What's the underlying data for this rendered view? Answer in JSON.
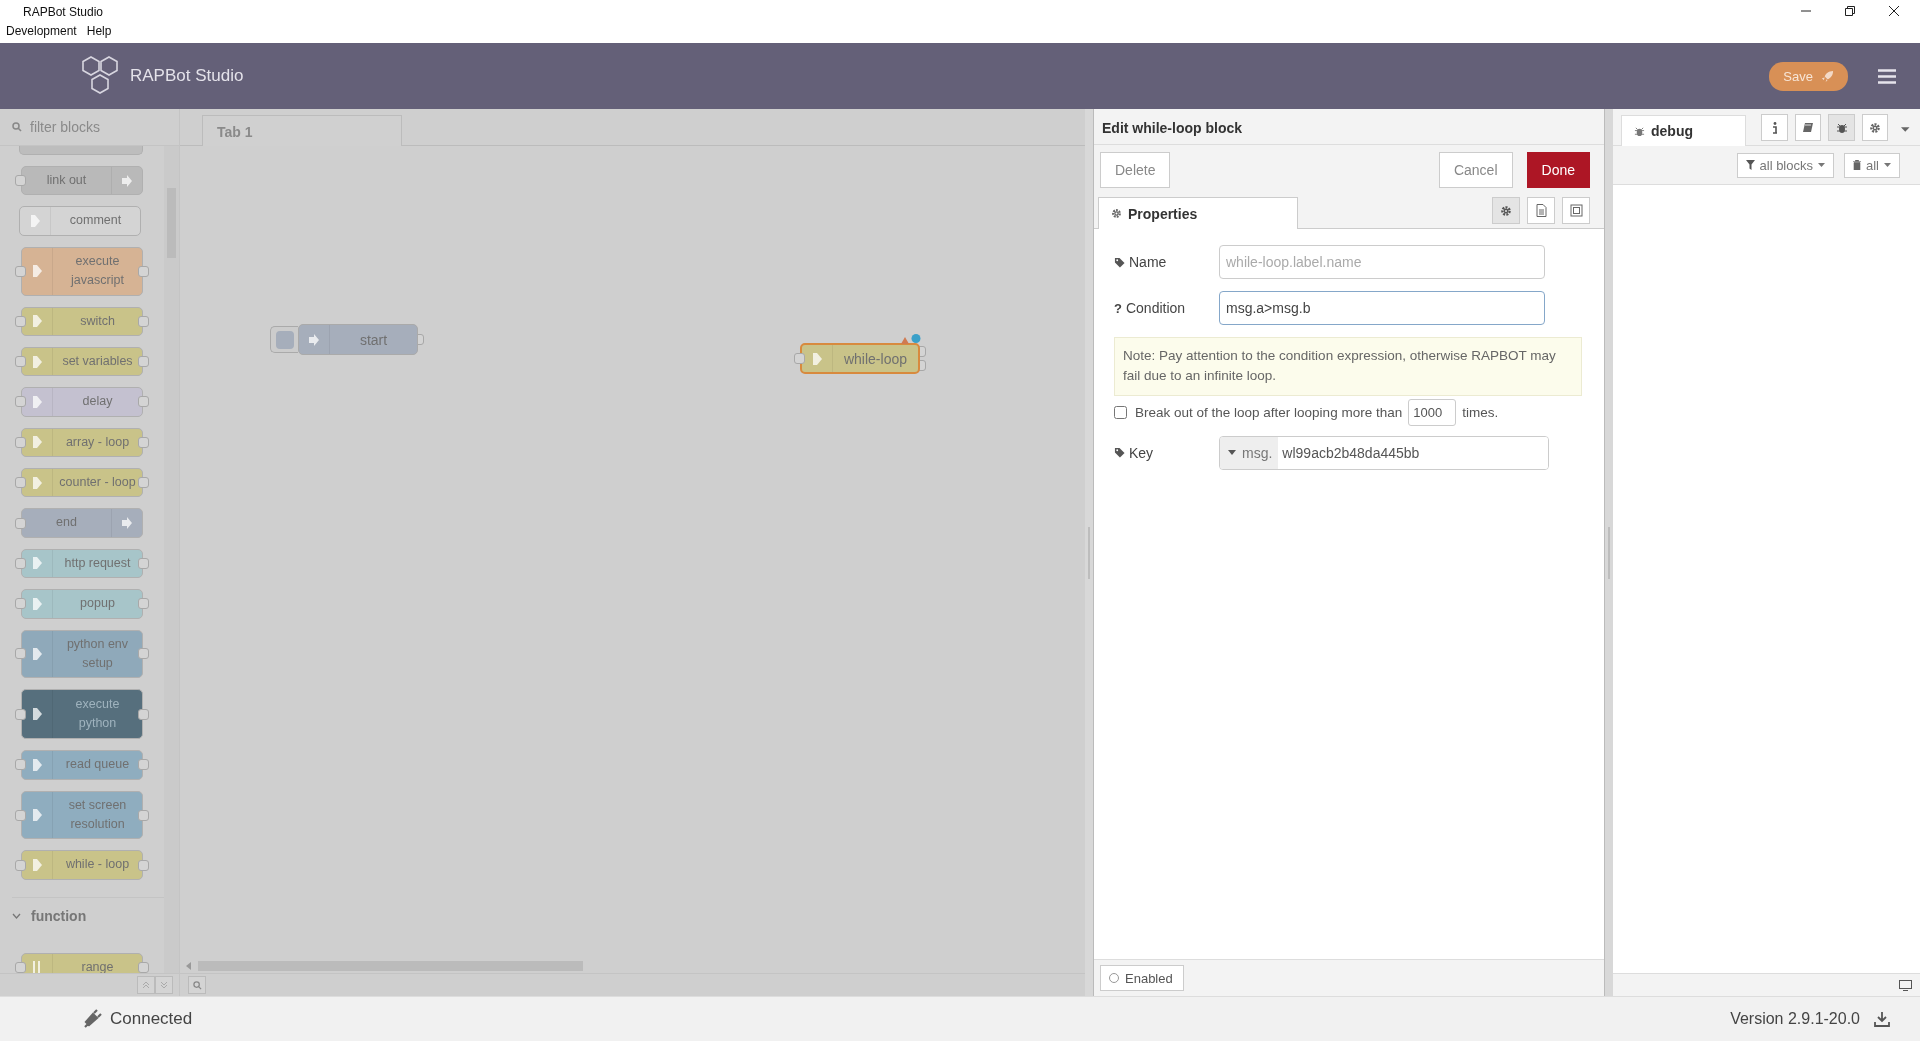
{
  "window": {
    "title": "RAPBot Studio"
  },
  "menu_bar": [
    "Development",
    "Help"
  ],
  "header": {
    "title": "RAPBot Studio",
    "save_button": "Save"
  },
  "palette": {
    "search": {
      "placeholder": "filter blocks"
    },
    "nodes": [
      {
        "label": "link out",
        "color": "#b9b9b9",
        "kind": "sink"
      },
      {
        "label": "comment",
        "color": "#d4d4d4",
        "kind": "note"
      },
      {
        "label": "execute javascript",
        "color": "#d6b394",
        "kind": "process"
      },
      {
        "label": "switch",
        "color": "#c9c389",
        "kind": "process"
      },
      {
        "label": "set variables",
        "color": "#c9c389",
        "kind": "process"
      },
      {
        "label": "delay",
        "color": "#c4c1d0",
        "kind": "process"
      },
      {
        "label": "array - loop",
        "color": "#c9c389",
        "kind": "process"
      },
      {
        "label": "counter - loop",
        "color": "#c9c389",
        "kind": "process"
      },
      {
        "label": "end",
        "color": "#a6aebb",
        "kind": "sink"
      },
      {
        "label": "http request",
        "color": "#a7c5c9",
        "kind": "process"
      },
      {
        "label": "popup",
        "color": "#a7c5c9",
        "kind": "process"
      },
      {
        "label": "python env setup",
        "color": "#8fa9ba",
        "kind": "process"
      },
      {
        "label": "execute python",
        "color": "#566f7d",
        "kind": "process"
      },
      {
        "label": "read queue",
        "color": "#8fadbf",
        "kind": "process"
      },
      {
        "label": "set screen resolution",
        "color": "#8fadbf",
        "kind": "process"
      },
      {
        "label": "while - loop",
        "color": "#c9c389",
        "kind": "process"
      }
    ],
    "category": {
      "label": "function",
      "expanded": true,
      "nodes": [
        {
          "label": "range",
          "color": "#c9c389",
          "kind": "process"
        }
      ]
    }
  },
  "workspace": {
    "tabs": [
      {
        "label": "Tab 1",
        "selected": true
      }
    ],
    "nodes": [
      {
        "label": "start",
        "color": "#a6aebb",
        "kind": "inject",
        "selected": false,
        "changed": false
      },
      {
        "label": "while-loop",
        "color": "#c9c389",
        "kind": "loop",
        "selected": true,
        "changed": true
      }
    ]
  },
  "editor": {
    "title": "Edit while-loop block",
    "delete_button": "Delete",
    "cancel_button": "Cancel",
    "done_button": "Done",
    "tab": {
      "label": "Properties",
      "selected": true
    },
    "fields": [
      {
        "kind": "tag",
        "label": "Name",
        "placeholder": "while-loop.label.name",
        "focused": false
      },
      {
        "kind": "symbol",
        "symbol": "?",
        "label": "Condition",
        "value": "msg.a>msg.b",
        "focused": true
      }
    ],
    "note": "Note: Pay attention to the condition expression, otherwise RAPBOT may fail due to an infinite loop.",
    "break_option": {
      "label": "Break out of the loop after looping more than",
      "value": "1000",
      "suffix": "times.",
      "checked": false
    },
    "key": {
      "label": "Key",
      "prefix": "msg.",
      "value": "wl99acb2b48da445bb"
    },
    "enabled": {
      "label": "Enabled",
      "on": false
    }
  },
  "sidebar": {
    "tab": {
      "label": "debug",
      "selected": true
    },
    "filter": "all blocks",
    "clear": "all"
  },
  "status_bar": {
    "connection": "Connected",
    "version": "Version 2.9.1-20.0"
  }
}
